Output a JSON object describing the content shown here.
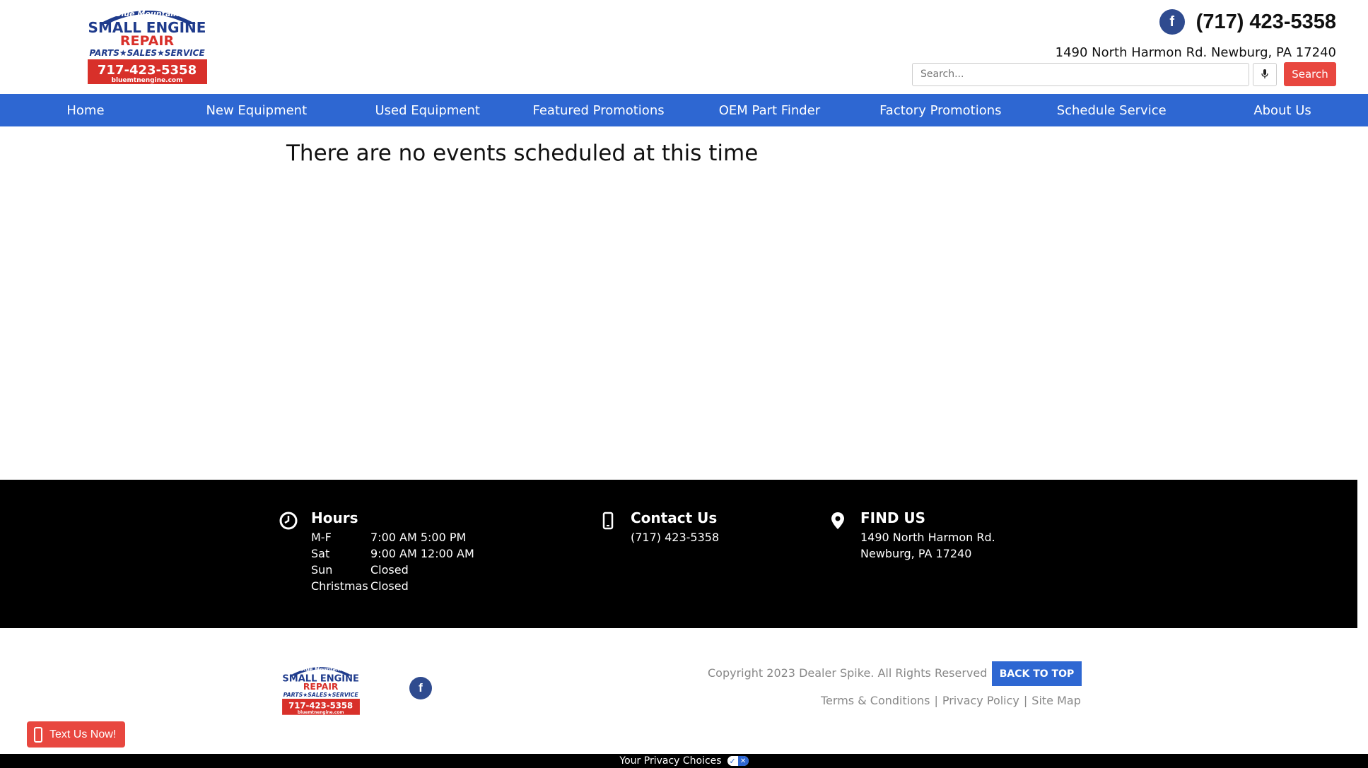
{
  "header": {
    "logo": {
      "top_text": "Blue Mountain",
      "line1": "SMALL ENGINE",
      "line2": "REPAIR",
      "line3": "PARTS★SALES★SERVICE",
      "phone": "717-423-5358",
      "url": "bluemtnengine.com"
    },
    "phone": "(717) 423-5358",
    "address": "1490 North Harmon Rd. Newburg, PA 17240",
    "search": {
      "placeholder": "Search...",
      "button_label": "Search"
    },
    "icons": {
      "facebook": "facebook-icon",
      "mic": "microphone-icon"
    }
  },
  "nav": {
    "items": [
      {
        "label": "Home"
      },
      {
        "label": "New Equipment"
      },
      {
        "label": "Used Equipment"
      },
      {
        "label": "Featured Promotions"
      },
      {
        "label": "OEM Part Finder"
      },
      {
        "label": "Factory Promotions"
      },
      {
        "label": "Schedule Service"
      },
      {
        "label": "About Us"
      }
    ]
  },
  "main": {
    "title": "There are no events scheduled at this time"
  },
  "footer": {
    "hours": {
      "heading": "Hours",
      "rows": [
        {
          "day": "M-F",
          "time": "7:00 AM 5:00 PM"
        },
        {
          "day": "Sat",
          "time": "9:00 AM 12:00 AM"
        },
        {
          "day": "Sun",
          "time": "Closed"
        },
        {
          "day": "Christmas",
          "time": "Closed"
        }
      ]
    },
    "contact": {
      "heading": "Contact Us",
      "phone": "(717) 423-5358"
    },
    "find": {
      "heading": "FIND US",
      "line1": "1490 North Harmon Rd.",
      "line2": "Newburg, PA 17240"
    },
    "copyright": "Copyright 2023 Dealer Spike. All Rights Reserved",
    "back_to_top": "BACK TO TOP",
    "links": [
      {
        "label": "Terms & Conditions"
      },
      {
        "label": "Privacy Policy"
      },
      {
        "label": "Site Map"
      }
    ]
  },
  "widgets": {
    "text_us": "Text Us Now!",
    "privacy": "Your Privacy Choices"
  },
  "colors": {
    "nav_blue": "#2e67d2",
    "accent_red": "#e8473f",
    "facebook_blue": "#2f4b8f",
    "footer_bg": "#000000"
  }
}
